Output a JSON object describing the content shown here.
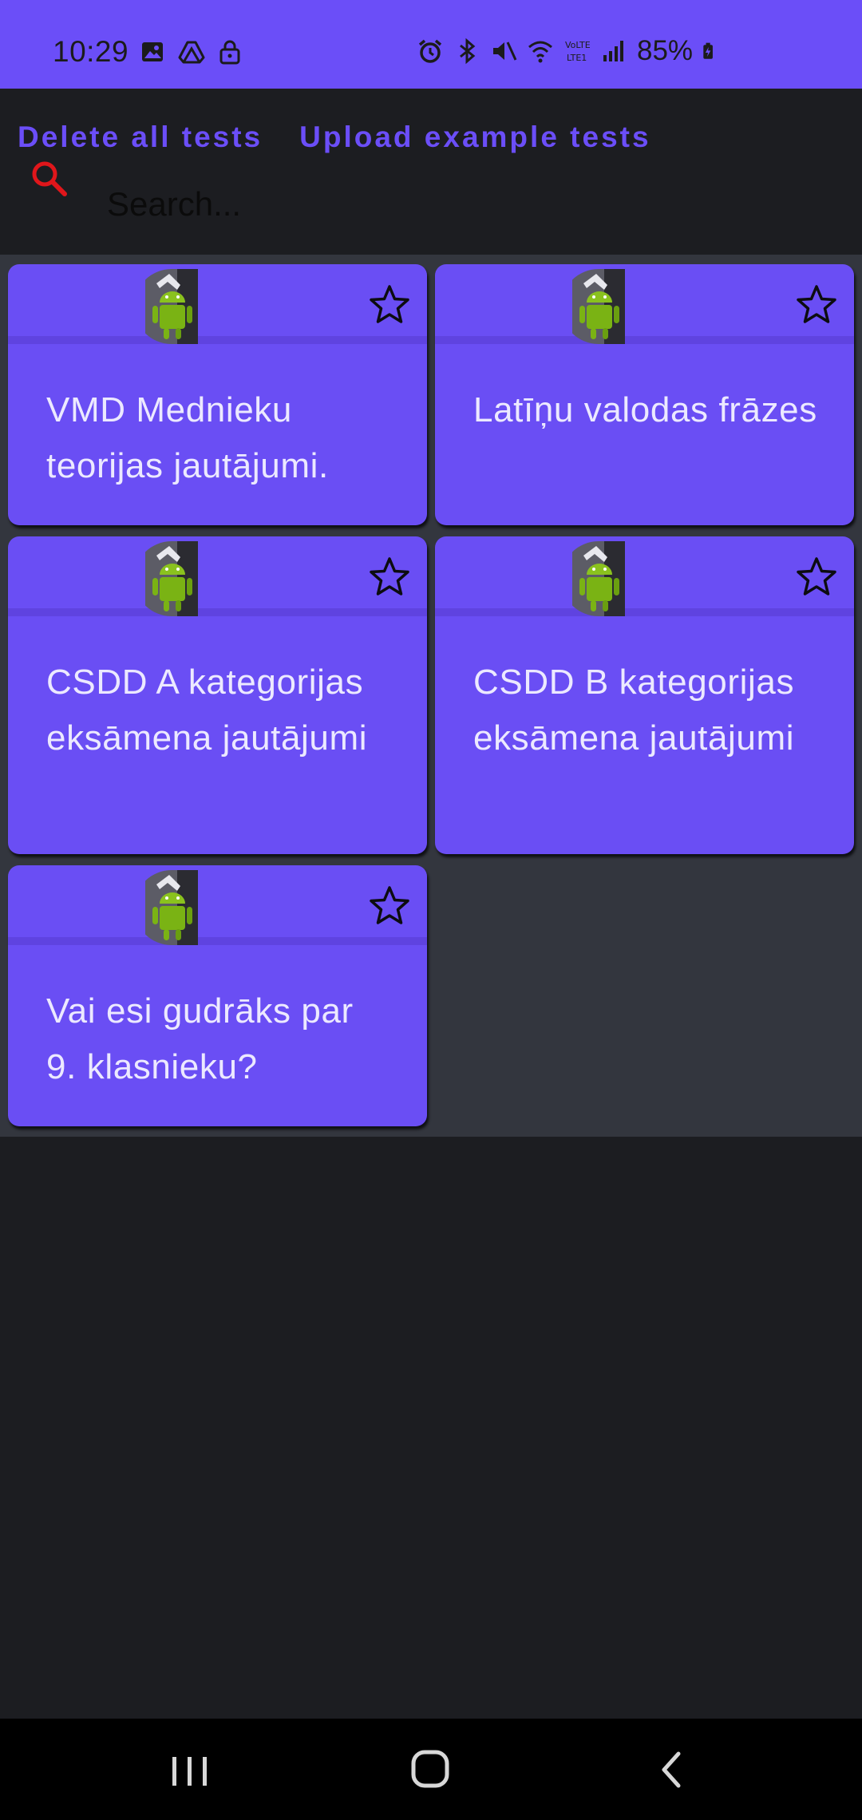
{
  "status_bar": {
    "time": "10:29",
    "battery": "85%",
    "left_icons": [
      "image-icon",
      "drive-icon",
      "lock-icon"
    ],
    "right_icons": [
      "alarm-icon",
      "bluetooth-icon",
      "mute-icon",
      "wifi-icon",
      "volte-icon",
      "signal-icon",
      "battery-charging-icon"
    ]
  },
  "header": {
    "delete_label": "Delete all tests",
    "upload_label": "Upload example tests"
  },
  "search": {
    "placeholder": "Search..."
  },
  "cards": [
    {
      "title": "VMD Mednieku teorijas jautājumi.",
      "icon": "android-avatar-icon",
      "favorite_icon": "star-outline-icon"
    },
    {
      "title": "Latīņu valodas frāzes",
      "icon": "android-avatar-icon",
      "favorite_icon": "star-outline-icon"
    },
    {
      "title": "CSDD A kategorijas eksāmena jautājumi",
      "icon": "android-avatar-icon",
      "favorite_icon": "star-outline-icon"
    },
    {
      "title": "CSDD B kategorijas eksāmena jautājumi",
      "icon": "android-avatar-icon",
      "favorite_icon": "star-outline-icon"
    },
    {
      "title": "Vai esi gudrāks par 9. klasnieku?",
      "icon": "android-avatar-icon",
      "favorite_icon": "star-outline-icon"
    }
  ],
  "nav": {
    "icons": [
      "recent-apps-icon",
      "home-icon",
      "back-icon"
    ]
  },
  "colors": {
    "primary": "#6b4ef8",
    "card": "#6a4ef4",
    "background": "#1c1d21",
    "grid_background": "#33363e",
    "search_icon": "#e0161b"
  }
}
